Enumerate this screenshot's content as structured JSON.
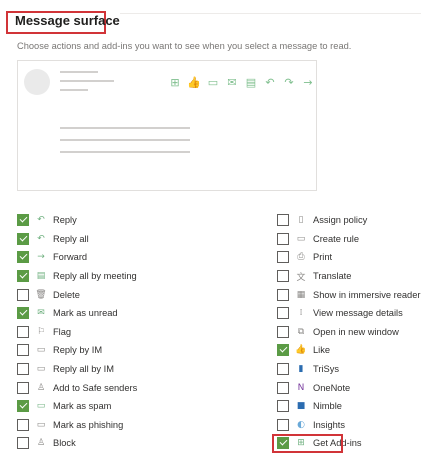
{
  "header": {
    "title": "Message surface",
    "subtitle": "Choose actions and add-ins you want to see when you select a message to read."
  },
  "preview": {
    "toolbar_icons": [
      "⊞",
      "👍",
      "▭",
      "✉",
      "▤",
      "↶",
      "↷",
      "→"
    ]
  },
  "left_options": [
    {
      "label": "Reply",
      "checked": true,
      "icon": "reply-icon",
      "glyph": "↶"
    },
    {
      "label": "Reply all",
      "checked": true,
      "icon": "reply-all-icon",
      "glyph": "↶"
    },
    {
      "label": "Forward",
      "checked": true,
      "icon": "forward-icon",
      "glyph": "→"
    },
    {
      "label": "Reply all by meeting",
      "checked": true,
      "icon": "calendar-icon",
      "glyph": "▤"
    },
    {
      "label": "Delete",
      "checked": false,
      "icon": "trash-icon",
      "glyph": "🗑"
    },
    {
      "label": "Mark as unread",
      "checked": true,
      "icon": "envelope-icon",
      "glyph": "✉"
    },
    {
      "label": "Flag",
      "checked": false,
      "icon": "flag-icon",
      "glyph": "⚐"
    },
    {
      "label": "Reply by IM",
      "checked": false,
      "icon": "chat-icon",
      "glyph": "▭"
    },
    {
      "label": "Reply all by IM",
      "checked": false,
      "icon": "chat-group-icon",
      "glyph": "▭"
    },
    {
      "label": "Add to Safe senders",
      "checked": false,
      "icon": "person-add-icon",
      "glyph": "♙"
    },
    {
      "label": "Mark as spam",
      "checked": true,
      "icon": "spam-icon",
      "glyph": "▭"
    },
    {
      "label": "Mark as phishing",
      "checked": false,
      "icon": "phishing-icon",
      "glyph": "▭"
    },
    {
      "label": "Block",
      "checked": false,
      "icon": "block-person-icon",
      "glyph": "♙"
    }
  ],
  "right_options": [
    {
      "label": "Assign policy",
      "checked": false,
      "icon": "policy-icon",
      "glyph": "▯"
    },
    {
      "label": "Create rule",
      "checked": false,
      "icon": "rule-icon",
      "glyph": "▭"
    },
    {
      "label": "Print",
      "checked": false,
      "icon": "print-icon",
      "glyph": "⎙"
    },
    {
      "label": "Translate",
      "checked": false,
      "icon": "translate-icon",
      "glyph": "文"
    },
    {
      "label": "Show in immersive reader",
      "checked": false,
      "icon": "immersive-reader-icon",
      "glyph": "▦"
    },
    {
      "label": "View message details",
      "checked": false,
      "icon": "details-icon",
      "glyph": "⁞"
    },
    {
      "label": "Open in new window",
      "checked": false,
      "icon": "open-window-icon",
      "glyph": "⧉"
    },
    {
      "label": "Like",
      "checked": true,
      "icon": "like-icon",
      "glyph": "👍"
    },
    {
      "label": "TriSys",
      "checked": false,
      "icon": "trisys-icon",
      "glyph": "▮"
    },
    {
      "label": "OneNote",
      "checked": false,
      "icon": "onenote-icon",
      "glyph": "N"
    },
    {
      "label": "Nimble",
      "checked": false,
      "icon": "nimble-icon",
      "glyph": "■"
    },
    {
      "label": "Insights",
      "checked": false,
      "icon": "insights-icon",
      "glyph": "◐"
    },
    {
      "label": "Get Add-ins",
      "checked": true,
      "icon": "add-ins-icon",
      "glyph": "⊞"
    }
  ]
}
